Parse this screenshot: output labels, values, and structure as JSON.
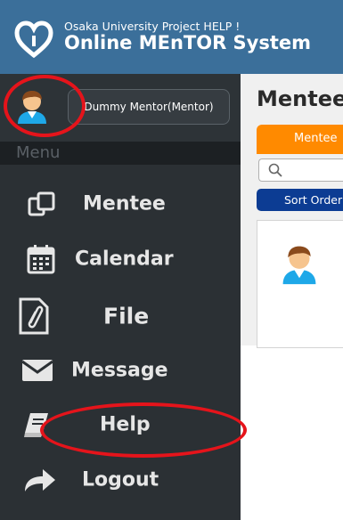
{
  "header": {
    "subtitle": "Osaka University Project HELP !",
    "title": "Online MEnTOR System"
  },
  "user": {
    "name": "Dummy Mentor(Mentor)"
  },
  "sidebar": {
    "menu_label": "Menu",
    "items": [
      {
        "label": "Mentee",
        "icon": "mentee-icon"
      },
      {
        "label": "Calendar",
        "icon": "calendar-icon"
      },
      {
        "label": "File",
        "icon": "file-icon"
      },
      {
        "label": "Message",
        "icon": "envelope-icon"
      },
      {
        "label": "Help",
        "icon": "book-icon"
      },
      {
        "label": "Logout",
        "icon": "share-arrow-icon"
      }
    ]
  },
  "main": {
    "title": "Mentee",
    "tab_label": "Mentee",
    "search_placeholder": "",
    "sort_label": "Sort Order"
  },
  "colors": {
    "header_bg": "#3b6f9a",
    "sidebar_bg": "#2b3034",
    "tab_orange": "#ff8a00",
    "sort_blue": "#0c3c93",
    "annotation_red": "#e5141b"
  }
}
